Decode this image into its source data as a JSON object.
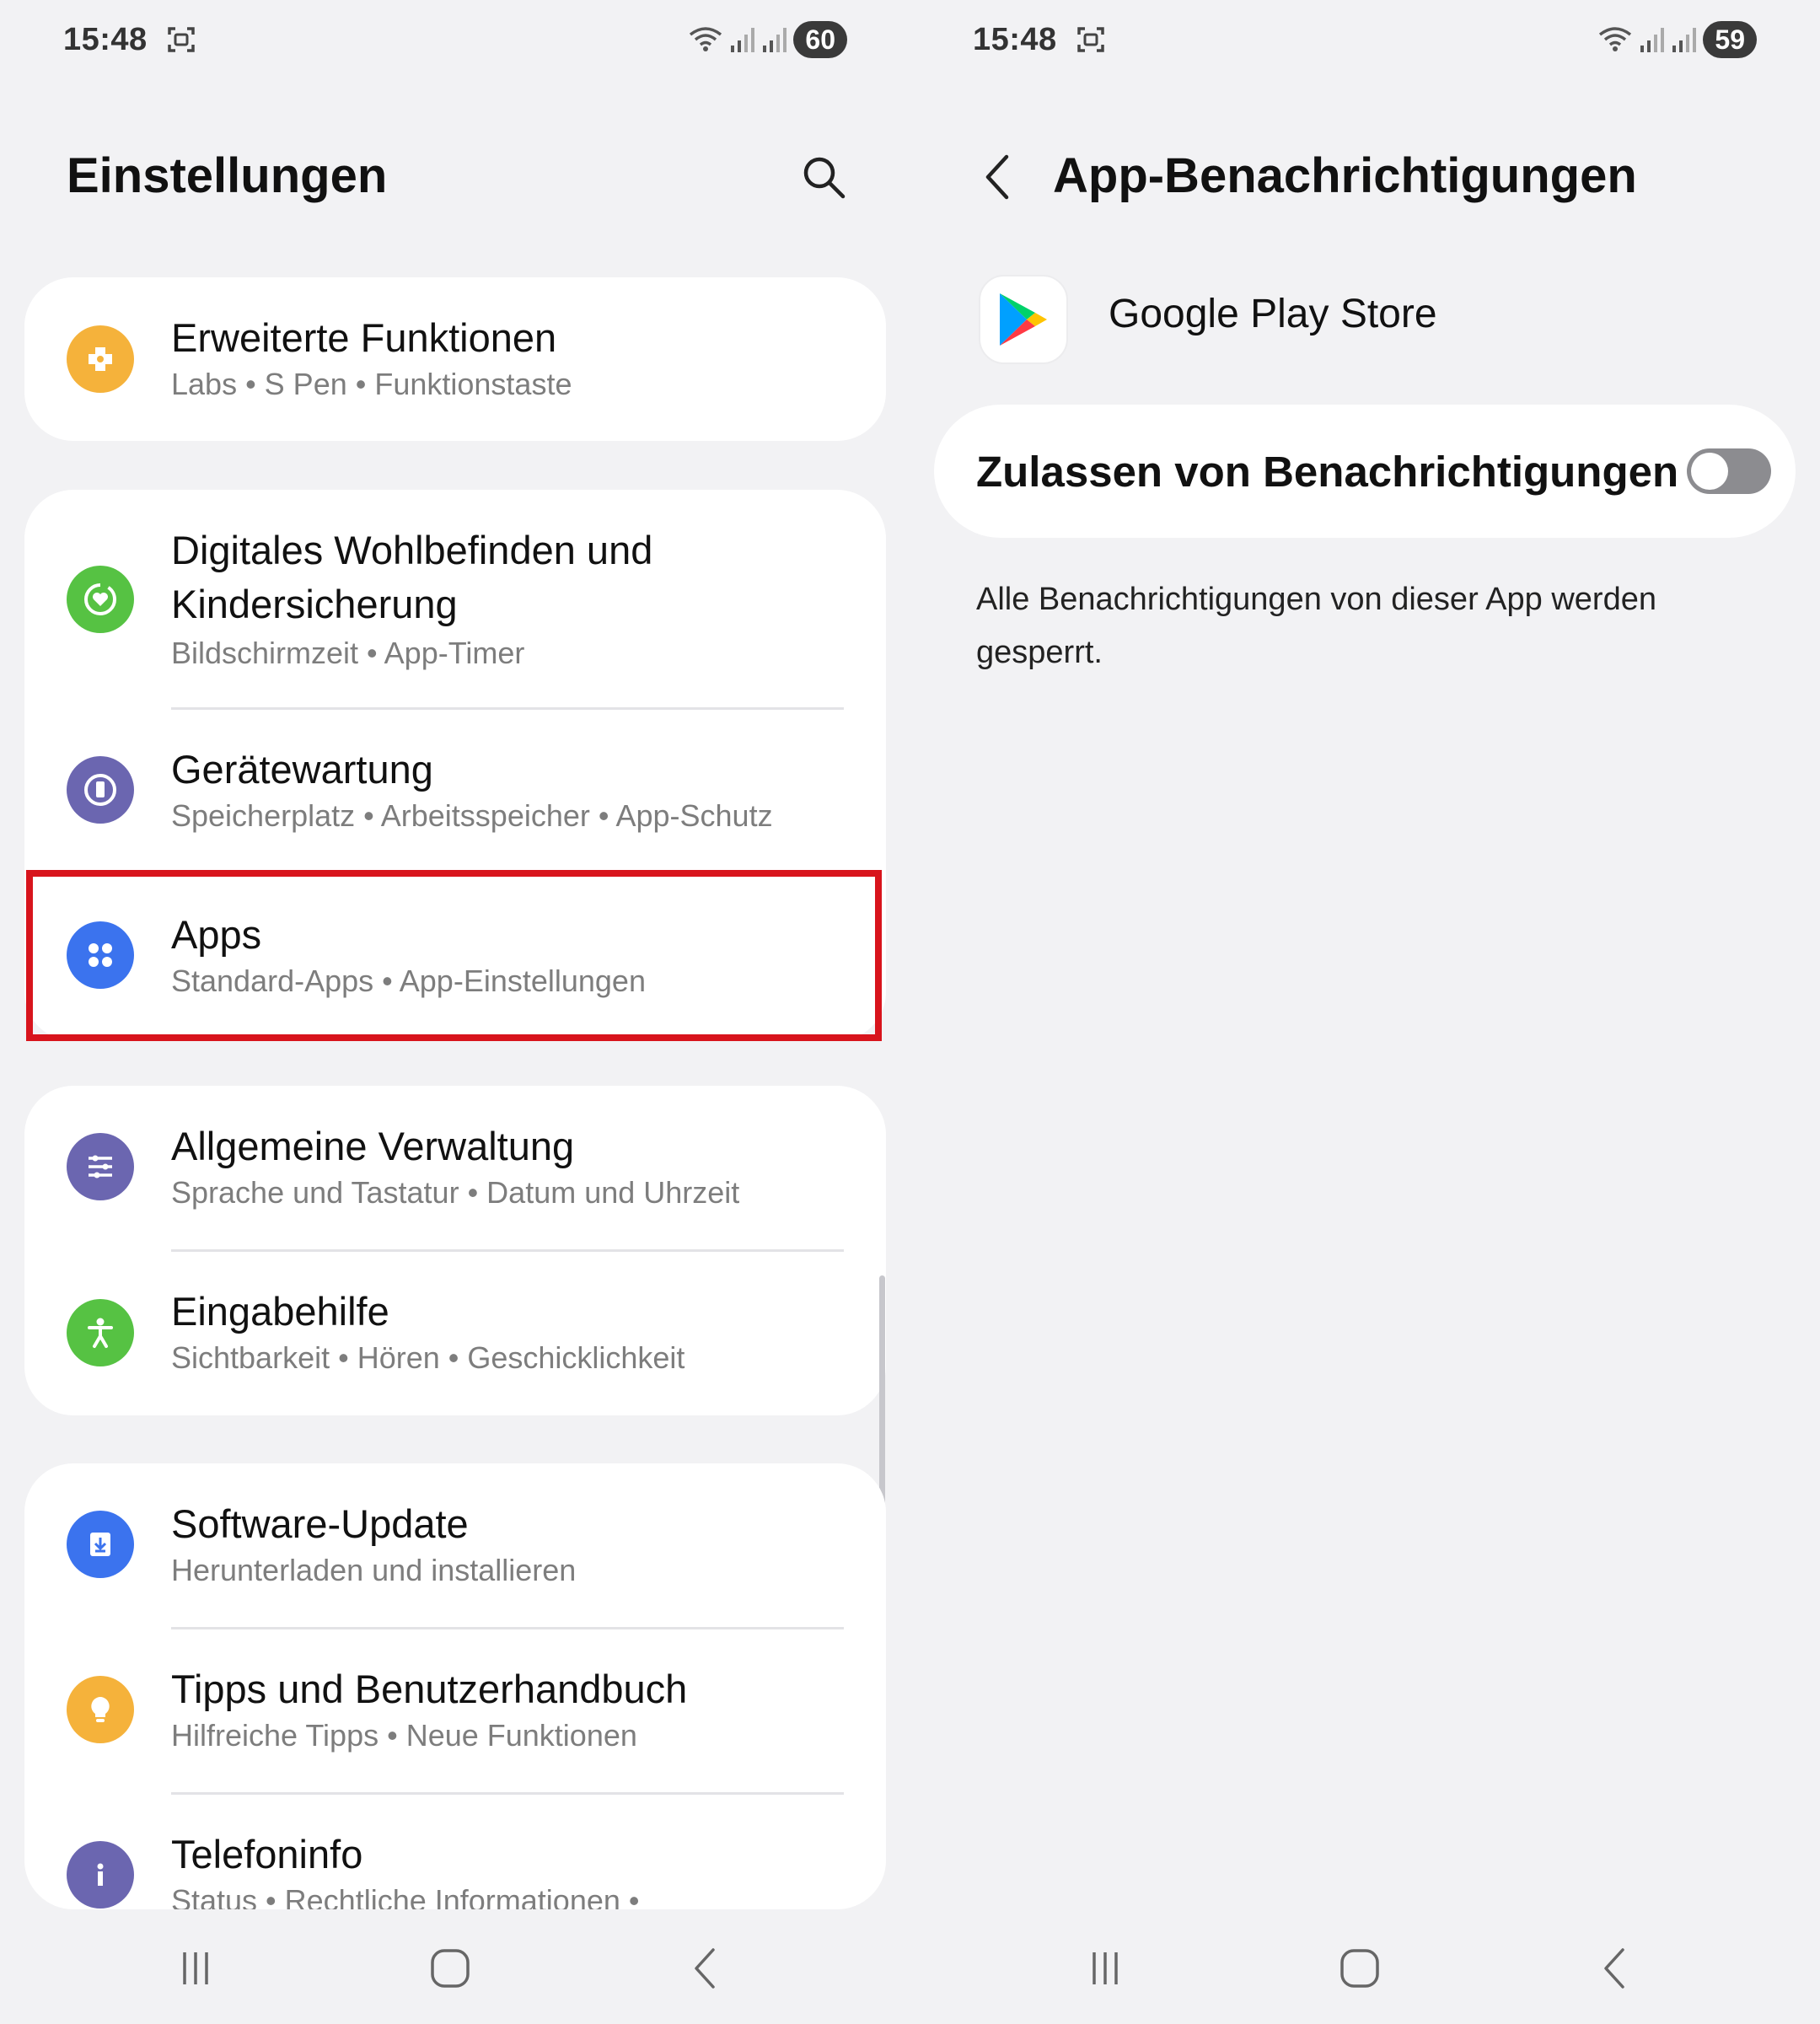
{
  "left_screen": {
    "status": {
      "time": "15:48",
      "battery": "60"
    },
    "title": "Einstellungen",
    "groups": [
      [
        {
          "title": "Erweiterte Funktionen",
          "subtitle": "Labs  •  S Pen  •  Funktionstaste",
          "icon": "advanced-features-icon",
          "color": "#f5b23b"
        }
      ],
      [
        {
          "title": "Digitales Wohlbefinden und Kindersicherung",
          "subtitle": "Bildschirmzeit  •  App-Timer",
          "icon": "digital-wellbeing-icon",
          "color": "#56c243"
        },
        {
          "title": "Gerätewartung",
          "subtitle": "Speicherplatz  •  Arbeitsspeicher  •  App-Schutz",
          "icon": "device-care-icon",
          "color": "#6b66b0"
        },
        {
          "title": "Apps",
          "subtitle": "Standard-Apps  •  App-Einstellungen",
          "icon": "apps-icon",
          "color": "#3b73ee"
        }
      ],
      [
        {
          "title": "Allgemeine Verwaltung",
          "subtitle": "Sprache und Tastatur  •  Datum und Uhrzeit",
          "icon": "general-management-icon",
          "color": "#6b66b0"
        },
        {
          "title": "Eingabehilfe",
          "subtitle": "Sichtbarkeit  •  Hören  •  Geschicklichkeit",
          "icon": "accessibility-icon",
          "color": "#56c243"
        }
      ],
      [
        {
          "title": "Software-Update",
          "subtitle": "Herunterladen und installieren",
          "icon": "software-update-icon",
          "color": "#3b73ee"
        },
        {
          "title": "Tipps und Benutzerhandbuch",
          "subtitle": "Hilfreiche Tipps  •  Neue Funktionen",
          "icon": "tips-icon",
          "color": "#f5b23b"
        },
        {
          "title": "Telefoninfo",
          "subtitle": "Status  •  Rechtliche Informationen  •",
          "icon": "phone-info-icon",
          "color": "#6b66b0"
        }
      ]
    ]
  },
  "right_screen": {
    "status": {
      "time": "15:48",
      "battery": "59"
    },
    "title": "App-Benachrichtigungen",
    "app_name": "Google Play Store",
    "toggle_label": "Zulassen von Benachrichtigungen",
    "toggle_on": false,
    "description": "Alle Benachrichtigungen von dieser App werden gesperrt."
  }
}
